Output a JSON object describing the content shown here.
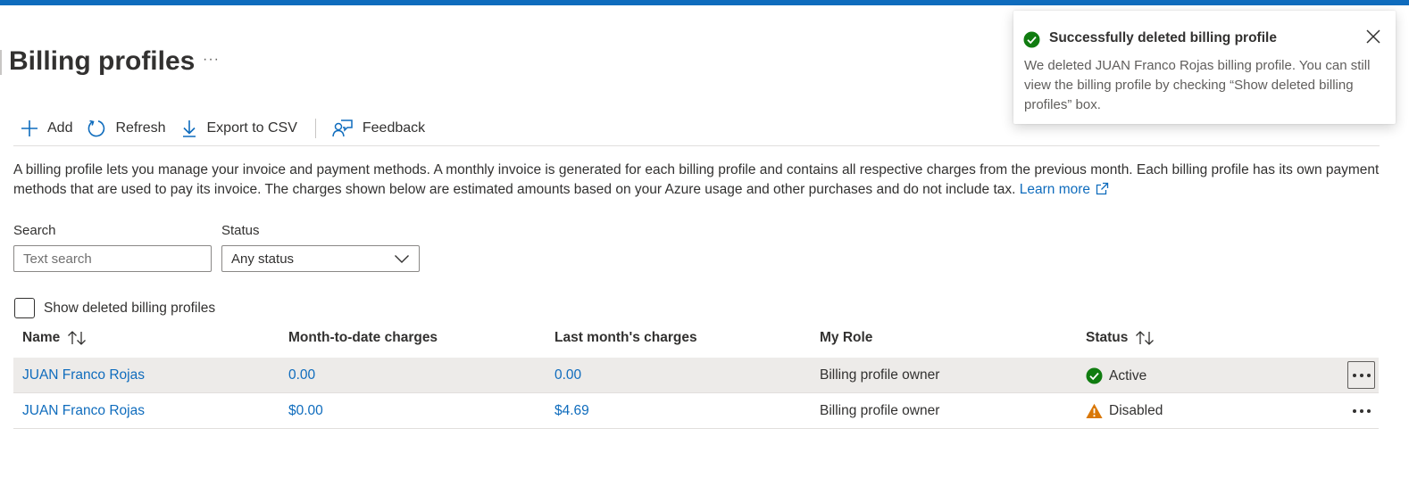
{
  "page": {
    "title": "Billing profiles",
    "more_label": "···"
  },
  "toolbar": {
    "add_label": "Add",
    "refresh_label": "Refresh",
    "export_label": "Export to CSV",
    "feedback_label": "Feedback"
  },
  "description": {
    "text": "A billing profile lets you manage your invoice and payment methods. A monthly invoice is generated for each billing profile and contains all respective charges from the previous month. Each billing profile has its own payment methods that are used to pay its invoice. The charges shown below are estimated amounts based on your Azure usage and other purchases and do not include tax.",
    "link_label": "Learn more"
  },
  "filters": {
    "search_label": "Search",
    "search_placeholder": "Text search",
    "status_label": "Status",
    "status_value": "Any status",
    "show_deleted_label": "Show deleted billing profiles",
    "show_deleted_checked": false
  },
  "table": {
    "columns": [
      "Name",
      "Month-to-date charges",
      "Last month's charges",
      "My Role",
      "Status"
    ],
    "rows": [
      {
        "name": "JUAN Franco Rojas",
        "mtd": "0.00",
        "last_month": "0.00",
        "role": "Billing profile owner",
        "status": "Active",
        "status_icon": "success-check-icon",
        "selected": true
      },
      {
        "name": "JUAN Franco Rojas",
        "mtd": "$0.00",
        "last_month": "$4.69",
        "role": "Billing profile owner",
        "status": "Disabled",
        "status_icon": "warning-icon",
        "selected": false
      }
    ]
  },
  "toast": {
    "title": "Successfully deleted billing profile",
    "body": "We deleted JUAN Franco Rojas billing profile. You can still view the billing profile by checking “Show deleted billing profiles” box."
  },
  "colors": {
    "accent": "#0f6cbd",
    "success": "#107c10",
    "warning": "#d97706",
    "selected_row": "#edebe9"
  }
}
